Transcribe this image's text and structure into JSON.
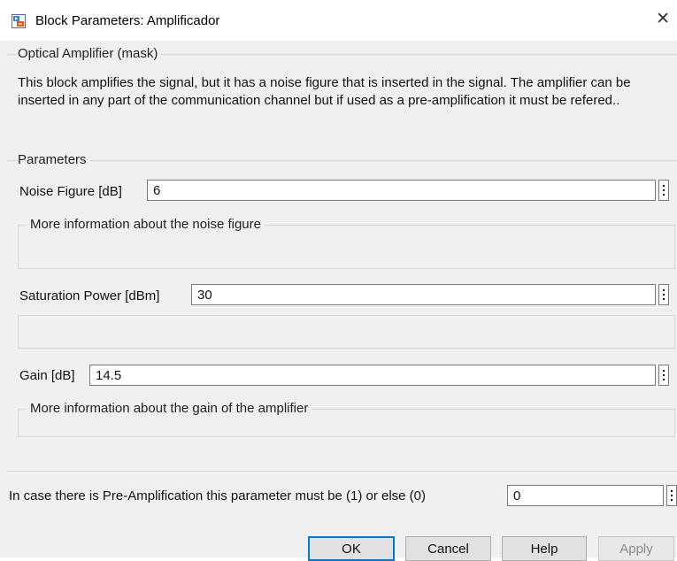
{
  "window": {
    "title": "Block Parameters: Amplificador",
    "close_glyph": "✕",
    "app_icon": "simulink-block-icon"
  },
  "mask": {
    "legend": "Optical Amplifier (mask)",
    "description": "This block amplifies the signal, but it has a noise figure that is inserted in the signal. The amplifier can be inserted in any part of the communication channel but if used as a pre-amplification it must be refered.."
  },
  "parameters": {
    "legend": "Parameters",
    "noise_figure": {
      "label": "Noise Figure [dB]",
      "value": "6",
      "info_legend": "More information about the noise figure"
    },
    "saturation_power": {
      "label": "Saturation Power [dBm]",
      "value": "30"
    },
    "gain": {
      "label": "Gain [dB]",
      "value": "14.5",
      "info_legend": "More information about the gain of the amplifier"
    },
    "preamp": {
      "label": "In case there is Pre-Amplification this parameter must be (1) or else (0)",
      "value": "0"
    }
  },
  "buttons": {
    "ok": "OK",
    "cancel": "Cancel",
    "help": "Help",
    "apply": "Apply"
  }
}
